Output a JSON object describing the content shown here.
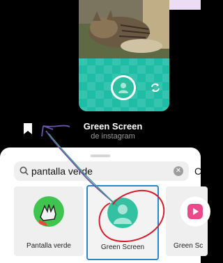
{
  "preview": {
    "title": "Green Screen",
    "subtitle": "de instagram"
  },
  "icons": {
    "bookmark": "bookmark-icon",
    "flip": "flip-camera-icon",
    "search": "search-icon",
    "clear": "clear-icon"
  },
  "search": {
    "value": "pantalla verde",
    "cancel_label": "C"
  },
  "effects": [
    {
      "label": "Pantalla verde"
    },
    {
      "label": "Green Screen"
    },
    {
      "label": "Green Sc"
    }
  ],
  "colors": {
    "accent": "#2a86c8",
    "green_screen": "#1fc1a8",
    "annotation_red": "#d9192a",
    "annotation_purple": "#6a55a8"
  }
}
